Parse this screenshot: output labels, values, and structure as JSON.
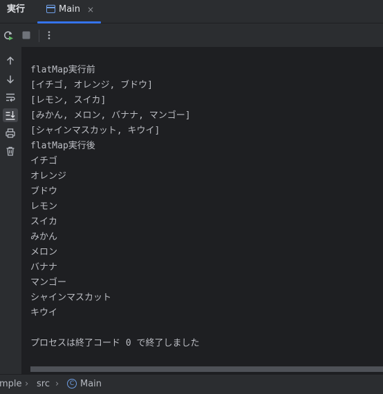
{
  "header": {
    "run_title": "実行",
    "tab": {
      "label": "Main",
      "close": "×"
    }
  },
  "toolbar": {
    "buttons": [
      {
        "name": "rerun-icon"
      },
      {
        "name": "stop-icon"
      },
      {
        "name": "more-options-icon"
      }
    ]
  },
  "gutter": {
    "buttons": [
      {
        "name": "scroll-up-icon"
      },
      {
        "name": "scroll-down-icon"
      },
      {
        "name": "soft-wrap-icon"
      },
      {
        "name": "scroll-to-end-icon",
        "active": true
      },
      {
        "name": "print-icon"
      },
      {
        "name": "clear-all-icon"
      }
    ]
  },
  "console": {
    "lines": [
      "flatMap実行前",
      "[イチゴ, オレンジ, ブドウ]",
      "[レモン, スイカ]",
      "[みかん, メロン, バナナ, マンゴー]",
      "[シャインマスカット, キウイ]",
      "flatMap実行後",
      "イチゴ",
      "オレンジ",
      "ブドウ",
      "レモン",
      "スイカ",
      "みかん",
      "メロン",
      "バナナ",
      "マンゴー",
      "シャインマスカット",
      "キウイ",
      "",
      "プロセスは終了コード 0 で終了しました"
    ]
  },
  "breadcrumb": {
    "project": "mple",
    "folder": "src",
    "class_badge": "C",
    "class": "Main",
    "separator": "›"
  },
  "colors": {
    "background": "#2b2d30",
    "console_background": "#1e1f22",
    "accent": "#3574f0",
    "text": "#bcbec4"
  }
}
